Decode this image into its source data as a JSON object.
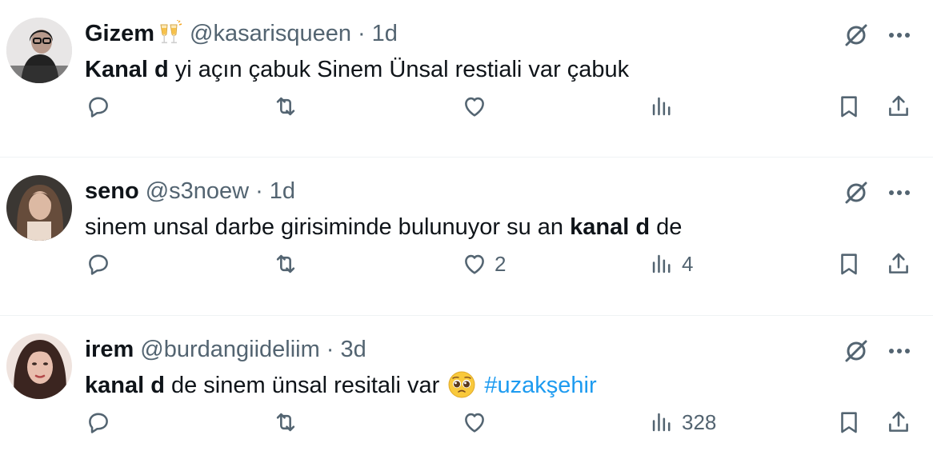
{
  "tweets": [
    {
      "name": "Gizem",
      "handle": "@kasarisqueen",
      "separator": "·",
      "time": "1d",
      "name_emoji": "clinking-glasses-emoji",
      "text": {
        "bold": "Kanal d",
        "rest": " yi açın çabuk Sinem Ünsal restiali var çabuk"
      },
      "counts": {
        "replies": "",
        "retweets": "",
        "likes": "",
        "views": ""
      }
    },
    {
      "name": "seno",
      "handle": "@s3noew",
      "separator": "·",
      "time": "1d",
      "text": {
        "before": "sinem unsal darbe girisiminde bulunuyor su an ",
        "bold": "kanal d",
        "after": " de"
      },
      "counts": {
        "replies": "",
        "retweets": "",
        "likes": "2",
        "views": "4"
      }
    },
    {
      "name": "irem",
      "handle": "@burdangiideliim",
      "separator": "·",
      "time": "3d",
      "text": {
        "bold": "kanal d",
        "rest": " de sinem ünsal resitali var ",
        "emoji": "pleading-face-emoji",
        "hashtag": "#uzakşehir"
      },
      "counts": {
        "replies": "",
        "retweets": "",
        "likes": "",
        "views": "328"
      }
    }
  ],
  "icons": {
    "reply": "reply-icon",
    "retweet": "retweet-icon",
    "like": "like-icon",
    "views": "views-icon",
    "bookmark": "bookmark-icon",
    "share": "share-icon",
    "grok": "grok-icon",
    "more": "more-icon"
  },
  "colors": {
    "text": "#0f1419",
    "secondary": "#536471",
    "hashtag": "#1d9bf0",
    "divider": "#eff3f4"
  }
}
